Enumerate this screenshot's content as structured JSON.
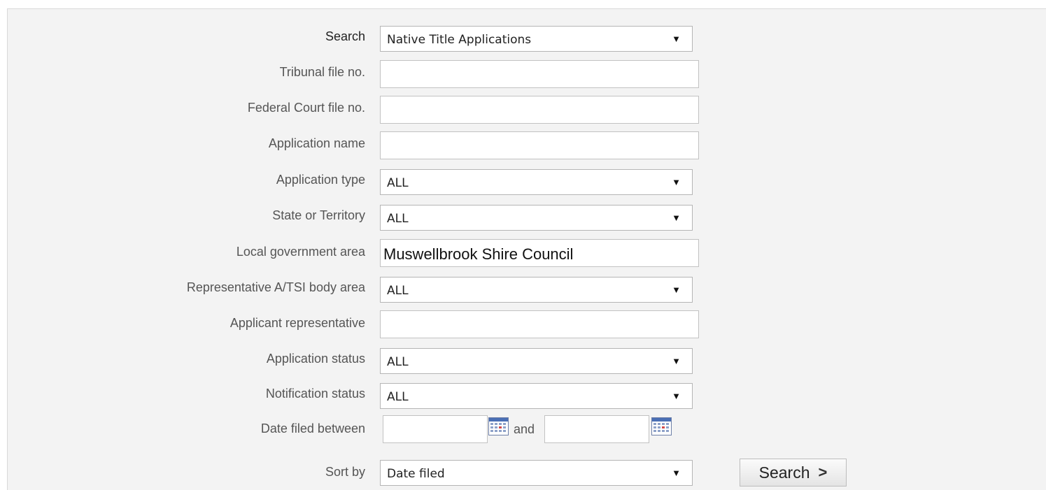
{
  "form": {
    "search": {
      "label": "Search",
      "value": "Native Title Applications"
    },
    "tribunal_file_no": {
      "label": "Tribunal file no.",
      "value": ""
    },
    "federal_court_file_no": {
      "label": "Federal Court file no.",
      "value": ""
    },
    "application_name": {
      "label": "Application name",
      "value": ""
    },
    "application_type": {
      "label": "Application type",
      "value": "ALL"
    },
    "state_or_territory": {
      "label": "State or Territory",
      "value": "ALL"
    },
    "local_government_area": {
      "label": "Local government area",
      "value": "Muswellbrook Shire Council"
    },
    "representative_body_area": {
      "label": "Representative A/TSI body area",
      "value": "ALL"
    },
    "applicant_representative": {
      "label": "Applicant representative",
      "value": ""
    },
    "application_status": {
      "label": "Application status",
      "value": "ALL"
    },
    "notification_status": {
      "label": "Notification status",
      "value": "ALL"
    },
    "date_filed": {
      "label": "Date filed between",
      "joiner": "and",
      "from": "",
      "to": ""
    },
    "sort_by": {
      "label": "Sort by",
      "value": "Date filed"
    },
    "search_button": {
      "label": "Search",
      "icon": "chevron-right-icon"
    }
  },
  "colors": {
    "panel_bg": "#f3f3f3",
    "label_text": "#555555",
    "field_border": "#c2c2c2"
  }
}
